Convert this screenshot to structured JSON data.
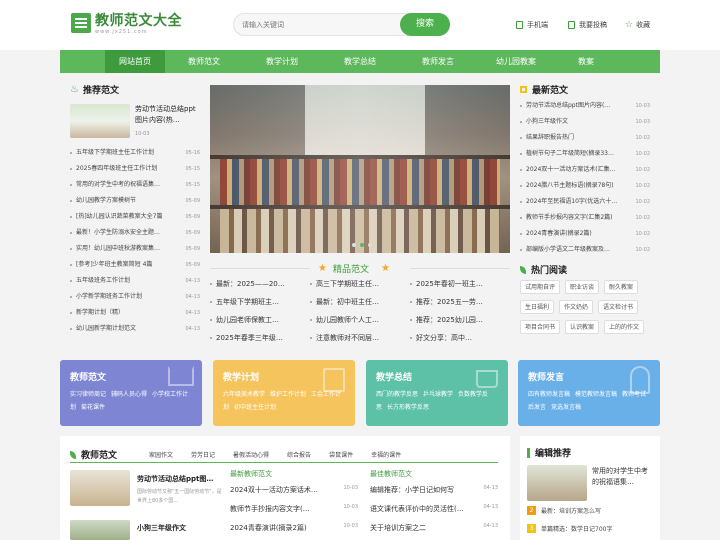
{
  "header": {
    "logo_title": "教师范文大全",
    "logo_sub": "www.jx251.com",
    "search_placeholder": "请输入关键词",
    "search_button": "搜索",
    "links": [
      "手机端",
      "我要投稿",
      "收藏"
    ]
  },
  "nav": [
    "网站首页",
    "教师范文",
    "教学计划",
    "教学总结",
    "教师发言",
    "幼儿园教案",
    "教案"
  ],
  "recommend": {
    "title": "推荐范文",
    "featured": {
      "title": "劳动节活动总结ppt图片内容(热…",
      "date": "10-03"
    },
    "items": [
      {
        "t": "五年级下学期班主任工作计划",
        "d": "05-16"
      },
      {
        "t": "2025春四年级班主任工作计划",
        "d": "05-15"
      },
      {
        "t": "常用的对学生中考的祝福语集…",
        "d": "05-15"
      },
      {
        "t": "幼儿园教学方案模树节",
        "d": "05-09"
      },
      {
        "t": "[热]幼儿园认识蔬菜教案大全7篇",
        "d": "05-09"
      },
      {
        "t": "最新！小学生防溺水安全主题…",
        "d": "05-09"
      },
      {
        "t": "实用！幼儿园中班秋游教案集…",
        "d": "05-09"
      },
      {
        "t": "[参考]少年班主教案简短 4篇",
        "d": "05-09"
      },
      {
        "t": "五年级班务工作计划",
        "d": "04-13"
      },
      {
        "t": "小学新学期班务工作计划",
        "d": "04-13"
      },
      {
        "t": "新学期计划（精）",
        "d": "04-13"
      },
      {
        "t": "幼儿园新学期计划范文",
        "d": "04-13"
      }
    ]
  },
  "boutique": {
    "title": "精品范文",
    "items": [
      "最新：2025——20…",
      "高三下学期班主任…",
      "2025年春初一班主…",
      "五年级下学期班主…",
      "最新：初中班主任…",
      "推荐：2025五一劳…",
      "幼儿园老师保教工…",
      "幼儿园教师个人工…",
      "推荐：2025幼儿园…",
      "2025年春季三年级…",
      "注意教师对不同层…",
      "好文分享：高中…"
    ]
  },
  "latest": {
    "title": "最新范文",
    "items": [
      {
        "t": "劳动节活动总结ppt图片内容(…",
        "d": "10-03"
      },
      {
        "t": "小狗三年级作文",
        "d": "10-03"
      },
      {
        "t": "结果辞职报告热门",
        "d": "10-02"
      },
      {
        "t": "植树节句子二年级简短(摘录33…",
        "d": "10-02"
      },
      {
        "t": "2024双十一活动方案话术(汇集…",
        "d": "10-02"
      },
      {
        "t": "2024腊八节主题标语(摘录78句)",
        "d": "10-02"
      },
      {
        "t": "2024年至民福语10字(优选六十…",
        "d": "10-02"
      },
      {
        "t": "教师节手抄报内容文字(汇集2篇)",
        "d": "10-02"
      },
      {
        "t": "2024青春演讲(摘录2篇)",
        "d": "10-02"
      },
      {
        "t": "部编版小学语文二年级教案及…",
        "d": "10-02"
      }
    ]
  },
  "hot": {
    "title": "热门阅读",
    "tags": [
      "试用期自评",
      "职业访谈",
      "耐久教案",
      "生日福利",
      "作文奶奶",
      "语文检讨书",
      "项目合同书",
      "认识教案",
      "上的的作文"
    ]
  },
  "cards": [
    {
      "title": "教师范文",
      "links": [
        "实习律师周记",
        "辅码人员心得",
        "小学校工作计划",
        "菊花课件"
      ],
      "color": "#7e86d3"
    },
    {
      "title": "教学计划",
      "links": [
        "六年级美术教学",
        "维护工作计划",
        "工会工作计划",
        "初中班主任计划"
      ],
      "color": "#f6c45d"
    },
    {
      "title": "教学总结",
      "links": [
        "西门的教学反思",
        "乒乓球教学",
        "负数教学反思",
        "长方形教学反思"
      ],
      "color": "#5dc1a7"
    },
    {
      "title": "教师发言",
      "links": [
        "四有教师发言稿",
        "模范教师发言稿",
        "教师考试后发言",
        "竞选发言稿"
      ],
      "color": "#6ab0e8"
    }
  ],
  "bottom": {
    "title": "教师范文",
    "tabs": [
      "家园作文",
      "劳芳日记",
      "暑假活动心得",
      "综合报告",
      "袋鼠课件",
      "幸福的课件"
    ],
    "features": [
      {
        "title": "劳动节活动总结ppt图…",
        "desc": "国际劳动节又称\"五一国际劳动节\"，是世界上80多个国…"
      },
      {
        "title": "小狗三年级作文",
        "desc": ""
      }
    ],
    "col1_title": "最新教师范文",
    "col1": [
      {
        "t": "2024双十一活动方案话术…",
        "d": "10-03"
      },
      {
        "t": "教师节手抄报内容文字(…",
        "d": "10-03"
      },
      {
        "t": "2024青春演讲(摘录2篇)",
        "d": "10-03"
      }
    ],
    "col2_title": "最佳教师范文",
    "col2": [
      {
        "t": "编辑推荐：小学日记如何写",
        "d": "04-13"
      },
      {
        "t": "语文课代表评价中的灵活性(…",
        "d": "04-13"
      },
      {
        "t": "关于培训方案之二",
        "d": "04-13"
      }
    ]
  },
  "editor": {
    "title": "编辑推荐",
    "featured": "常用的对学生中考的祝福语集…",
    "items": [
      {
        "n": "2",
        "t": "最新：培训方案怎么写"
      },
      {
        "n": "3",
        "t": "单篇精选：数学日记700字"
      }
    ]
  }
}
